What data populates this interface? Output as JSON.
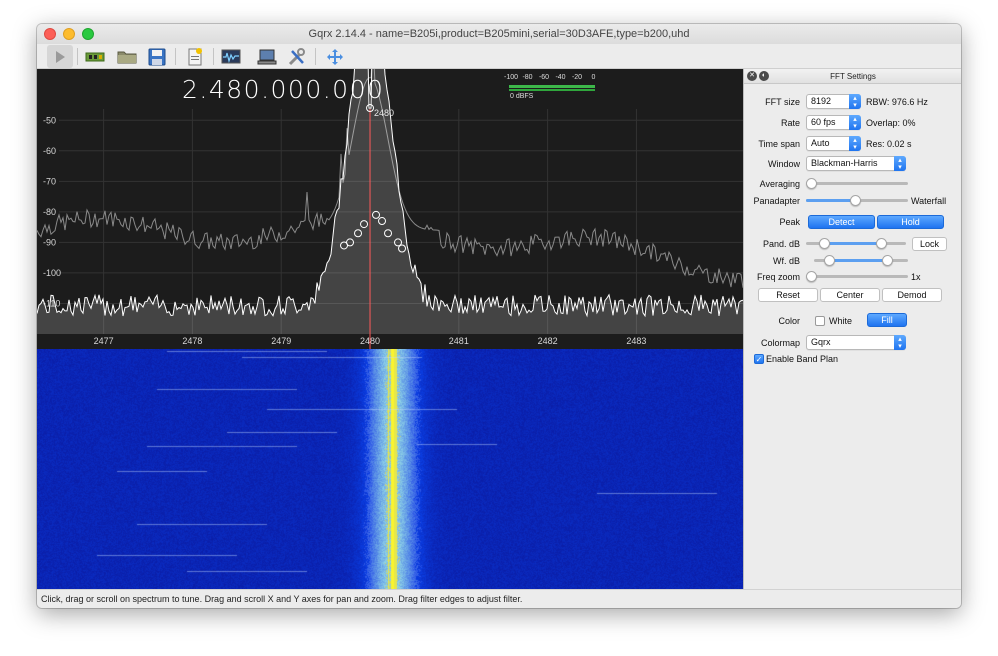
{
  "window": {
    "title": "Gqrx 2.14.4 - name=B205i,product=B205mini,serial=30D3AFE,type=b200,uhd"
  },
  "toolbar": {
    "buttons": [
      {
        "name": "start-dsp",
        "icon": "play-icon"
      },
      {
        "name": "configure-device",
        "icon": "device-board-icon"
      },
      {
        "name": "open-file",
        "icon": "folder-icon"
      },
      {
        "name": "save",
        "icon": "floppy-disk-icon"
      },
      {
        "name": "bookmarks",
        "icon": "document-star-icon"
      },
      {
        "name": "remote-control",
        "icon": "monitor-wave-icon"
      },
      {
        "name": "network",
        "icon": "computer-icon"
      },
      {
        "name": "settings",
        "icon": "wrench-screwdriver-icon"
      },
      {
        "name": "fullscreen",
        "icon": "move-arrows-icon"
      }
    ]
  },
  "display": {
    "frequency": "2.480.000.000",
    "marker_label": "2480",
    "meter": {
      "scale": [
        "-100",
        "-80",
        "-60",
        "-40",
        "-20",
        "0"
      ],
      "label": "0 dBFS",
      "color": "#3db84a"
    },
    "spectrum": {
      "y_ticks": [
        "-50",
        "-60",
        "-70",
        "-80",
        "-90",
        "-100",
        "-110"
      ],
      "y_values": [
        -50,
        -60,
        -70,
        -80,
        -90,
        -100,
        -110
      ],
      "x_ticks": [
        "2477",
        "2478",
        "2479",
        "2480",
        "2481",
        "2482",
        "2483"
      ],
      "x_values": [
        2477,
        2478,
        2479,
        2480,
        2481,
        2482,
        2483
      ],
      "x_range": [
        2476.25,
        2484.2
      ],
      "y_range": [
        -45,
        -120
      ],
      "center": 2480,
      "noise_floor": -112,
      "peak_value": -46,
      "peak_hold_floor": -86,
      "background": "#1c1c1c",
      "trace_color": "#ffffff",
      "marker_color": "#ff5a5a"
    },
    "waterfall": {
      "colormap": "Gqrx",
      "background": "#0b1b9e"
    }
  },
  "fft_panel": {
    "title": "FFT Settings",
    "fft_size": {
      "label": "FFT size",
      "value": "8192",
      "info": "RBW: 976.6 Hz"
    },
    "rate": {
      "label": "Rate",
      "value": "60 fps",
      "info": "Overlap: 0%"
    },
    "time_span": {
      "label": "Time span",
      "value": "Auto",
      "info": "Res: 0.02 s"
    },
    "window": {
      "label": "Window",
      "value": "Blackman-Harris"
    },
    "averaging": {
      "label": "Averaging",
      "level": 0.0
    },
    "panadapter_waterfall": {
      "left_label": "Panadapter",
      "right_label": "Waterfall",
      "level": 0.48
    },
    "peak": {
      "label": "Peak",
      "detect": "Detect",
      "hold": "Hold"
    },
    "pand_db": {
      "label": "Pand. dB",
      "low": 0.15,
      "high": 0.79,
      "lock": "Lock"
    },
    "wf_db": {
      "label": "Wf. dB",
      "low": 0.12,
      "high": 0.82
    },
    "freq_zoom": {
      "label": "Freq zoom",
      "value": "1x",
      "level": 0.0
    },
    "buttons": {
      "reset": "Reset",
      "center": "Center",
      "demod": "Demod"
    },
    "color": {
      "label": "Color",
      "white": "White",
      "fill": "Fill"
    },
    "colormap": {
      "label": "Colormap",
      "value": "Gqrx"
    },
    "band_plan": {
      "label": "Enable Band Plan",
      "checked": true
    },
    "accent": "#1f74f0"
  },
  "status": {
    "text": "Click, drag or scroll on spectrum to tune. Drag and scroll X and Y axes for pan and zoom. Drag filter edges to adjust filter."
  }
}
